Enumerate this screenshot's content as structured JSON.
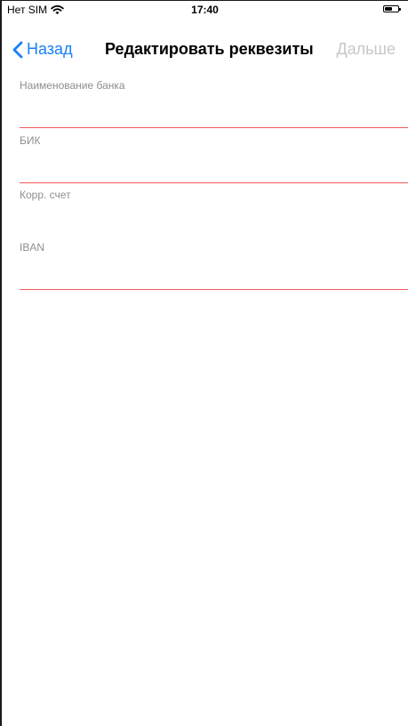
{
  "status_bar": {
    "carrier": "Нет SIM",
    "time": "17:40",
    "wifi_icon": "wifi-icon",
    "battery_icon": "battery-icon"
  },
  "nav": {
    "back_label": "Назад",
    "title": "Редактировать реквезиты",
    "next_label": "Дальше",
    "accent_color": "#1a7ff5",
    "disabled_color": "#c7c7cc"
  },
  "form": {
    "fields": [
      {
        "label": "Наименование банка",
        "value": "",
        "error": true
      },
      {
        "label": "БИК",
        "value": "",
        "error": true
      },
      {
        "label": "Корр. счет",
        "value": "",
        "error": false
      },
      {
        "label": "IBAN",
        "value": "",
        "error": true
      }
    ],
    "error_color": "#f25a5a"
  }
}
